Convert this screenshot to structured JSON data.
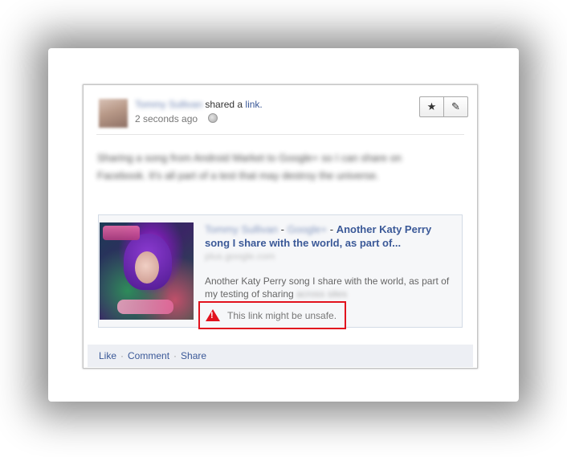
{
  "post": {
    "actor_name": "Tommy Sullivan",
    "action_text": "shared a",
    "action_link": "link.",
    "timestamp": "2 seconds ago",
    "privacy_icon": "globe-icon",
    "message": "Sharing a song from Android Market to Google+ so I can share on Facebook. It's all part of a test that may destroy the universe."
  },
  "toolbar": {
    "star_icon": "★",
    "edit_icon": "✎"
  },
  "attachment": {
    "artist_blur": "Tommy Sullivan",
    "source_blur": "Google+",
    "title": "Another Katy Perry song I share with the world, as part of...",
    "domain_blur": "plus.google.com",
    "description": "Another Katy Perry song I share with the world, as part of my testing of sharing",
    "description_tail_blur": "across sites"
  },
  "warning": {
    "icon": "warning-triangle-icon",
    "text": "This link might be unsafe.",
    "color": "#e2121e"
  },
  "footer": {
    "like": "Like",
    "comment": "Comment",
    "share": "Share",
    "separator": "·"
  },
  "colors": {
    "link": "#3b5998",
    "footer_bg": "#edeff4"
  }
}
